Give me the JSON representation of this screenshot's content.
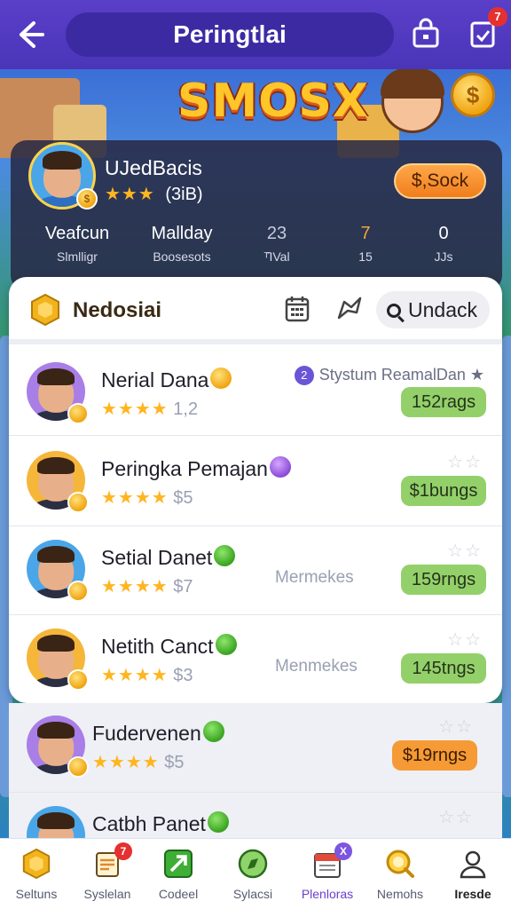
{
  "header": {
    "back_icon": "arrow-left-icon",
    "title": "Peringtlai",
    "bag_icon": "bag-icon",
    "notify_icon": "clipboard-icon",
    "notify_count": "7"
  },
  "banner": {
    "logo": "SMOSX",
    "coin_symbol": "$"
  },
  "profile": {
    "name": "UJedBacis",
    "stars": "★★★",
    "rating": "(3iB)",
    "button": "$,Sock",
    "coin_symbol": "$",
    "stats": [
      {
        "value": "Veafcun",
        "label": "Slmlligr"
      },
      {
        "value": "Mallday",
        "label": "Boosesots"
      },
      {
        "value": "23",
        "label": "ᵀ̂IVal"
      },
      {
        "value": "7",
        "label": "15"
      },
      {
        "value": "0",
        "label": "JJs"
      }
    ]
  },
  "leaderboard": {
    "title": "Nedosiai",
    "search_label": "Undack",
    "rows": [
      {
        "name": "Nerial Dana",
        "stars": "★★★★",
        "score": "1,2",
        "side_num": "2",
        "side_text": "Stystum ReamalDan ★",
        "mid": "",
        "pill": "152rags",
        "pill_color": "green",
        "badge": "gold"
      },
      {
        "name": "Peringka Pemajan",
        "stars": "★★★★",
        "score": "$5",
        "side_num": "",
        "side_text": "",
        "mid": "",
        "pill": "$1bungs",
        "pill_color": "green",
        "badge": "purple"
      },
      {
        "name": "Setial Danet",
        "stars": "★★★★",
        "score": "$7",
        "side_num": "",
        "side_text": "",
        "mid": "Mermekes",
        "pill": "159rngs",
        "pill_color": "green",
        "badge": "green"
      },
      {
        "name": "Netith Canct",
        "stars": "★★★★",
        "score": "$3",
        "side_num": "",
        "side_text": "",
        "mid": "Menmekes",
        "pill": "145tngs",
        "pill_color": "green",
        "badge": "green"
      },
      {
        "name": "Fudervenen",
        "stars": "★★★★",
        "score": "$5",
        "side_num": "",
        "side_text": "",
        "mid": "",
        "pill": "$19rngs",
        "pill_color": "orange",
        "badge": "green"
      },
      {
        "name": "Catbh Panet",
        "stars": "",
        "score": "",
        "side_num": "",
        "side_text": "",
        "mid": "",
        "pill": "",
        "pill_color": "orange",
        "badge": "green"
      }
    ]
  },
  "nav": [
    {
      "label": "Seltuns",
      "icon": "trophy-icon",
      "badge": ""
    },
    {
      "label": "Syslelan",
      "icon": "scroll-icon",
      "badge": "7"
    },
    {
      "label": "Codeel",
      "icon": "arrow-up-icon",
      "badge": ""
    },
    {
      "label": "Sylacsi",
      "icon": "compass-icon",
      "badge": ""
    },
    {
      "label": "Plenloras",
      "icon": "calendar-icon",
      "badge": "X"
    },
    {
      "label": "Nemohs",
      "icon": "search-coin-icon",
      "badge": ""
    },
    {
      "label": "Iresde",
      "icon": "person-icon",
      "badge": ""
    }
  ]
}
